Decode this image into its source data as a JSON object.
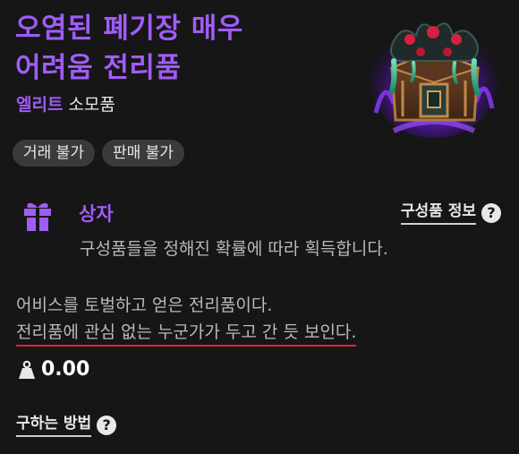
{
  "item": {
    "title_line1": "오염된 폐기장 매우",
    "title_line2": "어려움 전리품",
    "grade": "엘리트",
    "category": "소모품",
    "image_icon": "corrupted-treasure-chest-icon",
    "accent_color": "#a05cf7"
  },
  "tags": [
    "거래 불가",
    "판매 불가"
  ],
  "box": {
    "icon": "gift-icon",
    "label": "상자",
    "info_link": "구성품 정보",
    "description": "구성품들을 정해진 확률에 따라 획득합니다."
  },
  "lore": {
    "line1": "어비스를 토벌하고 얻은 전리품이다.",
    "line2": "전리품에 관심 없는 누군가가 두고 간 듯 보인다."
  },
  "weight": {
    "icon": "weight-icon",
    "value": "0.00"
  },
  "how_to_obtain": {
    "label": "구하는 방법"
  }
}
